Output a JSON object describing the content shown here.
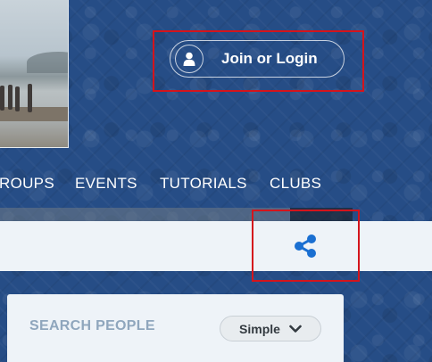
{
  "header": {
    "login_label": "Join or Login",
    "login_icon": "user-icon"
  },
  "nav": {
    "items": [
      {
        "label": "ROUPS"
      },
      {
        "label": "EVENTS"
      },
      {
        "label": "TUTORIALS"
      },
      {
        "label": "CLUBS"
      }
    ]
  },
  "toolbar": {
    "share_icon": "share-icon",
    "accent": "#1a6fd1"
  },
  "search_people": {
    "title": "SEARCH PEOPLE",
    "mode_label": "Simple",
    "mode_icon": "chevron-down-icon"
  },
  "colors": {
    "background": "#264d86",
    "highlight_frame": "#d4141c",
    "panel": "#eef3f8",
    "card_title": "#8fa6bd"
  }
}
